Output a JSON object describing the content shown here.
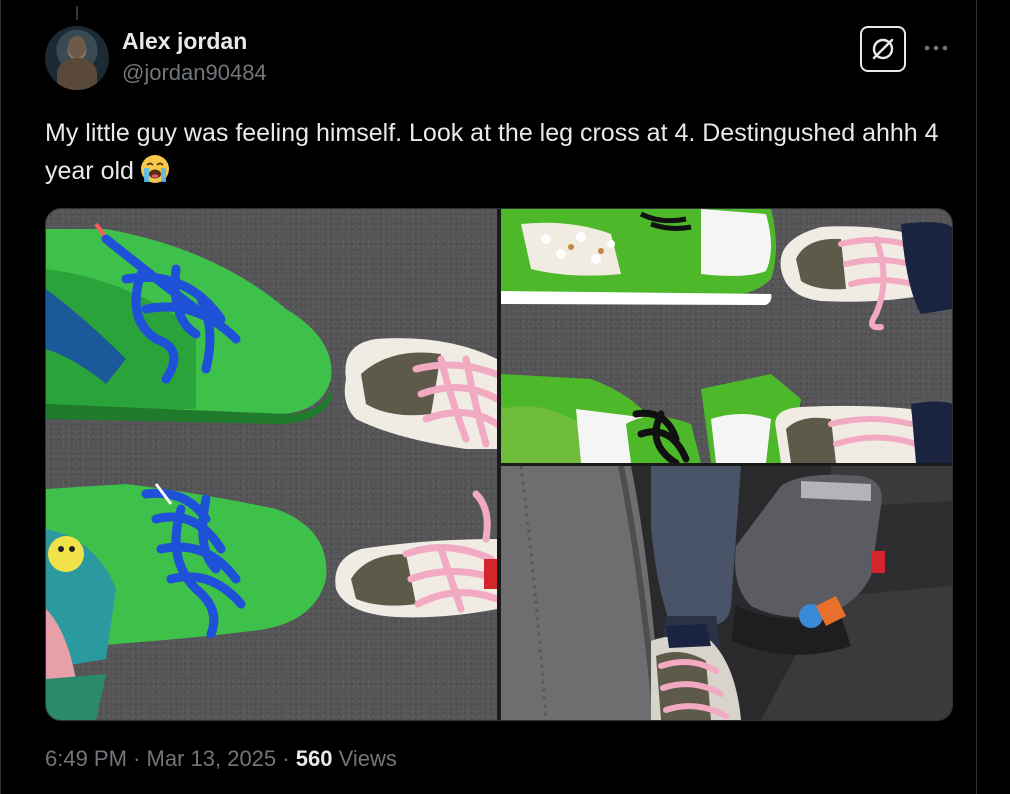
{
  "author": {
    "name": "Alex jordan",
    "handle": "@jordan90484"
  },
  "tweet": {
    "text": "My little guy was feeling himself. Look at the leg cross at 4. Destingushed ahhh 4 year old",
    "emoji": "loudly-crying-face"
  },
  "media": {
    "photos": [
      {
        "label": "photo-1",
        "description_icon": "sneakers-green-fuzzy-and-pink-lace"
      },
      {
        "label": "photo-2",
        "description_icon": "sneakers-green-star-dunks-and-pink-lace"
      },
      {
        "label": "photo-3",
        "description_icon": "child-leg-in-car-seat"
      }
    ]
  },
  "meta": {
    "time": "6:49 PM",
    "separator": "·",
    "date": "Mar 13, 2025",
    "views_count": "560",
    "views_label": "Views"
  },
  "colors": {
    "background": "#000000",
    "text_primary": "#e7e9ea",
    "text_secondary": "#71767b",
    "border": "#2f3336"
  }
}
